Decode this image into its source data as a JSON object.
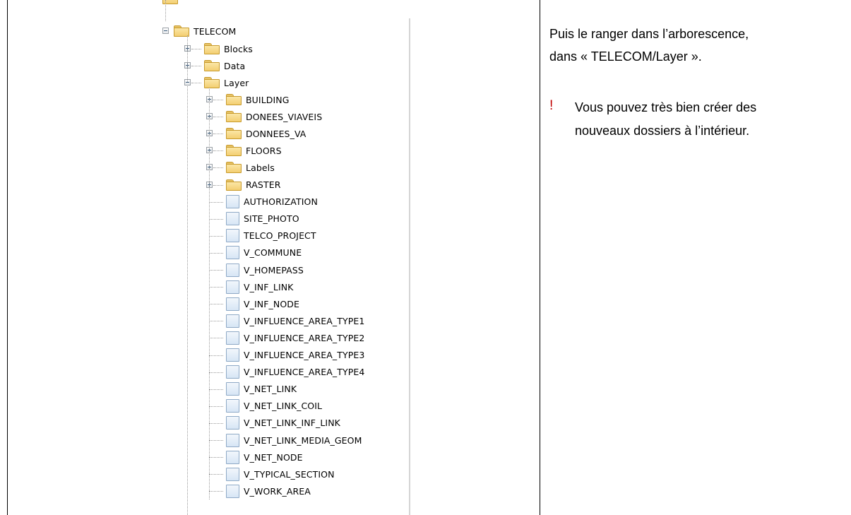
{
  "tree": {
    "root": {
      "label": "TELECOM",
      "expanded": true
    },
    "root_children": [
      {
        "label": "Blocks",
        "type": "folder",
        "expanded": false
      },
      {
        "label": "Data",
        "type": "folder",
        "expanded": false
      },
      {
        "label": "Layer",
        "type": "folder",
        "expanded": true
      }
    ],
    "layer_children": [
      {
        "label": "BUILDING",
        "type": "folder"
      },
      {
        "label": "DONEES_VIAVEIS",
        "type": "folder"
      },
      {
        "label": "DONNEES_VA",
        "type": "folder"
      },
      {
        "label": "FLOORS",
        "type": "folder"
      },
      {
        "label": "Labels",
        "type": "folder"
      },
      {
        "label": "RASTER",
        "type": "folder"
      },
      {
        "label": "AUTHORIZATION",
        "type": "table"
      },
      {
        "label": "SITE_PHOTO",
        "type": "table"
      },
      {
        "label": "TELCO_PROJECT",
        "type": "table"
      },
      {
        "label": "V_COMMUNE",
        "type": "table"
      },
      {
        "label": "V_HOMEPASS",
        "type": "table"
      },
      {
        "label": "V_INF_LINK",
        "type": "table"
      },
      {
        "label": "V_INF_NODE",
        "type": "table"
      },
      {
        "label": "V_INFLUENCE_AREA_TYPE1",
        "type": "table"
      },
      {
        "label": "V_INFLUENCE_AREA_TYPE2",
        "type": "table"
      },
      {
        "label": "V_INFLUENCE_AREA_TYPE3",
        "type": "table"
      },
      {
        "label": "V_INFLUENCE_AREA_TYPE4",
        "type": "table"
      },
      {
        "label": "V_NET_LINK",
        "type": "table"
      },
      {
        "label": "V_NET_LINK_COIL",
        "type": "table"
      },
      {
        "label": "V_NET_LINK_INF_LINK",
        "type": "table"
      },
      {
        "label": "V_NET_LINK_MEDIA_GEOM",
        "type": "table"
      },
      {
        "label": "V_NET_NODE",
        "type": "table"
      },
      {
        "label": "V_TYPICAL_SECTION",
        "type": "table"
      },
      {
        "label": "V_WORK_AREA",
        "type": "table"
      }
    ]
  },
  "instructions": {
    "line1": "Puis le ranger dans l’arborescence,",
    "line2": "dans « TELECOM/Layer ».",
    "note_marker": "!",
    "note_line1": "Vous pouvez très bien créer des",
    "note_line2": "nouveaux dossiers à l’intérieur."
  },
  "colors": {
    "note_marker": "#c00000",
    "folder": "#f3cf72",
    "table_icon": "#d7e6f5"
  }
}
